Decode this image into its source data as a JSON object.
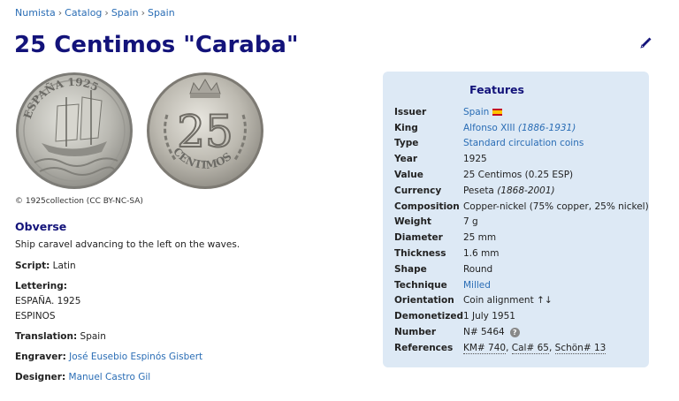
{
  "breadcrumb": [
    "Numista",
    "Catalog",
    "Spain",
    "Spain"
  ],
  "breadcrumb_sep": "›",
  "title": "25 Centimos \"Caraba\"",
  "coin": {
    "obverse_legend": "ESPAÑA 1925",
    "reverse_value": "25",
    "reverse_legend": "CENTIMOS"
  },
  "copyright": "© 1925collection (CC BY-NC-SA)",
  "obverse": {
    "title": "Obverse",
    "description": "Ship caravel advancing to the left on the waves.",
    "script_label": "Script:",
    "script_value": "Latin",
    "lettering_label": "Lettering:",
    "lettering_line1": "ESPAÑA. 1925",
    "lettering_line2": "ESPINOS",
    "translation_label": "Translation:",
    "translation_value": "Spain",
    "engraver_label": "Engraver:",
    "engraver_value": "José Eusebio Espinós Gisbert",
    "designer_label": "Designer:",
    "designer_value": "Manuel Castro Gil"
  },
  "features": {
    "title": "Features",
    "issuer_label": "Issuer",
    "issuer_value": "Spain",
    "king_label": "King",
    "king_value": "Alfonso XIII",
    "king_years": "(1886-1931)",
    "type_label": "Type",
    "type_value": "Standard circulation coins",
    "year_label": "Year",
    "year_value": "1925",
    "value_label": "Value",
    "value_value": "25 Centimos (0.25 ESP)",
    "currency_label": "Currency",
    "currency_value": "Peseta",
    "currency_years": "(1868-2001)",
    "composition_label": "Composition",
    "composition_value": "Copper-nickel (75% copper, 25% nickel)",
    "weight_label": "Weight",
    "weight_value": "7 g",
    "diameter_label": "Diameter",
    "diameter_value": "25 mm",
    "thickness_label": "Thickness",
    "thickness_value": "1.6 mm",
    "shape_label": "Shape",
    "shape_value": "Round",
    "technique_label": "Technique",
    "technique_value": "Milled",
    "orientation_label": "Orientation",
    "orientation_value": "Coin alignment ↑↓",
    "demonetized_label": "Demonetized",
    "demonetized_value": "1 July 1951",
    "number_label": "Number",
    "number_value": "N# 5464",
    "references_label": "References",
    "references": [
      "KM# 740",
      "Cal# 65",
      "Schön# 13"
    ],
    "help_glyph": "?"
  }
}
